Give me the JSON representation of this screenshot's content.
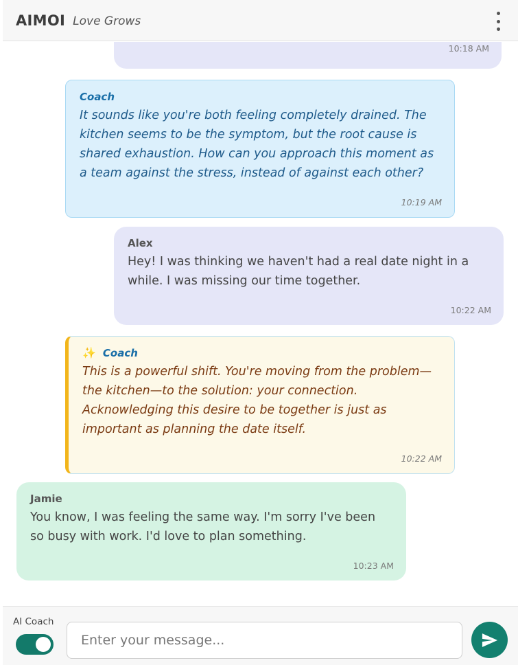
{
  "header": {
    "brand": "AIMOI",
    "tagline": "Love Grows",
    "menu_icon": "more-vertical-icon"
  },
  "messages": [
    {
      "type": "partner",
      "time": "10:18 AM"
    },
    {
      "type": "coach",
      "sender": "Coach",
      "text": "It sounds like you're both feeling completely drained. The kitchen seems to be the symptom, but the root cause is shared exhaustion. How can you approach this moment as a team against the stress, instead of against each other?",
      "time": "10:19 AM"
    },
    {
      "type": "partner",
      "sender": "Alex",
      "text": "Hey! I was thinking we haven't had a real date night in a while. I was missing our time together.",
      "time": "10:22 AM"
    },
    {
      "type": "coach-highlight",
      "icon": "sparkles-icon",
      "sender": "Coach",
      "text": "This is a powerful shift. You're moving from the problem—the kitchen—to the solution: your connection. Acknowledging this desire to be together is just as important as planning the date itself.",
      "time": "10:22 AM"
    },
    {
      "type": "self",
      "sender": "Jamie",
      "text": "You know, I was feeling the same way. I'm sorry I've been so busy with work. I'd love to plan something.",
      "time": "10:23 AM"
    }
  ],
  "footer": {
    "ai_coach_label": "AI Coach",
    "ai_coach_enabled": true,
    "input_placeholder": "Enter your message...",
    "input_value": "",
    "send_icon": "send-icon"
  },
  "colors": {
    "accent": "#13806f",
    "coach_bg": "#dcf0fc",
    "partner_bg": "#e5e6f8",
    "self_bg": "#d5f3e3",
    "highlight_border": "#f2b51a"
  }
}
